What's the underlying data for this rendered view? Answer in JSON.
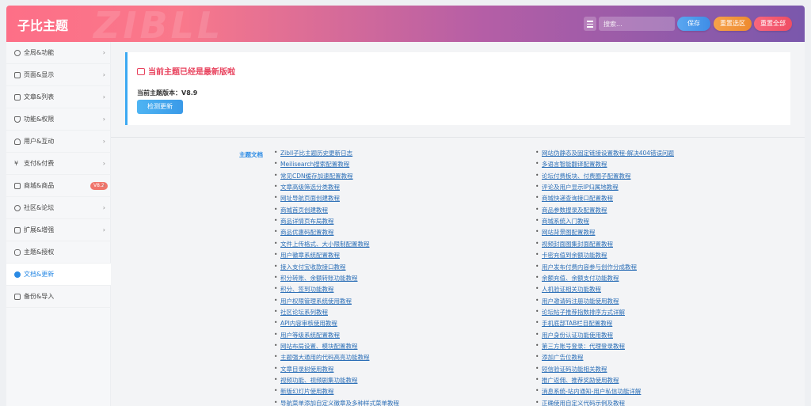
{
  "header": {
    "brand": "子比主题",
    "watermark": "ZIBLL",
    "search_placeholder": "搜索...",
    "save_label": "保存",
    "reset_section_label": "重置选区",
    "reset_all_label": "重置全部"
  },
  "sidebar": {
    "items": [
      {
        "label": "全局&功能",
        "icon": "globe-icon",
        "chevron": "›"
      },
      {
        "label": "页面&显示",
        "icon": "page-icon",
        "chevron": "›"
      },
      {
        "label": "文章&列表",
        "icon": "map-icon",
        "chevron": "›"
      },
      {
        "label": "功能&权限",
        "icon": "shield-icon",
        "chevron": "›"
      },
      {
        "label": "用户&互动",
        "icon": "user-icon",
        "chevron": "›"
      },
      {
        "label": "支付&付费",
        "icon": "yen-icon",
        "chevron": "›"
      },
      {
        "label": "商城&商品",
        "icon": "shop-icon",
        "chevron": "›",
        "badge": "V8.2"
      },
      {
        "label": "社区&论坛",
        "icon": "community-icon",
        "chevron": "›"
      },
      {
        "label": "扩展&增强",
        "icon": "puzzle-icon",
        "chevron": "›"
      },
      {
        "label": "主题&授权",
        "icon": "handshake-icon",
        "chevron": ""
      },
      {
        "label": "文档&更新",
        "icon": "cloud-download-icon",
        "chevron": "",
        "active": true
      },
      {
        "label": "备份&导入",
        "icon": "copy-icon",
        "chevron": ""
      }
    ]
  },
  "notice": {
    "title": "当前主题已经是最新版啦",
    "version_text": "当前主题版本：V8.9",
    "check_button": "检测更新"
  },
  "docs": {
    "label": "主题文档",
    "left_links": [
      "Zibll子比主题历史更新日志",
      "Meilisearch搜索配置教程",
      "常见CDN缓存加速配置教程",
      "文章高级筛选分类教程",
      "网址导航页面创建教程",
      "商城首页创建教程",
      "商品详情页布局教程",
      "商品优惠码配置教程",
      "文件上传格式、大小限制配置教程",
      "用户徽章系统配置教程",
      "接入支付宝收款接口教程",
      "积分转账、余额转账功能教程",
      "积分、签到功能教程",
      "用户权限管理系统使用教程",
      "社区论坛系列教程",
      "API内容审核使用教程",
      "用户等级系统配置教程",
      "网站布局设置、模块配置教程",
      "主题强大通用的代码高亮功能教程",
      "文章目录树使用教程",
      "视频功能、视频剧集功能教程",
      "新版幻灯片使用教程",
      "导航菜单添加自定义徽章及多种样式菜单教程"
    ],
    "right_links": [
      "网站伪静态及固定链接设置教程-解决404错误问题",
      "多语言智能翻译配置教程",
      "论坛付费板块、付费圈子配置教程",
      "评论及用户显示IP归属地教程",
      "商城快递查询接口配置教程",
      "商品参数搜录及配置教程",
      "商城系统入门教程",
      "网站背景图配置教程",
      "视频封面图集封面配置教程",
      "卡密充值到余额功能教程",
      "用户发布付费内容参与创作分成教程",
      "余额充值、余额支付功能教程",
      "人机验证相关功能教程",
      "用户邀请码注册功能使用教程",
      "论坛帖子推荐指数排序方式详解",
      "手机底部TAB栏目配置教程",
      "用户身份认证功能使用教程",
      "第三方账号登录：代理登录教程",
      "添加广告位教程",
      "短信验证码功能相关教程",
      "推广返佣、推荐奖励使用教程",
      "消息系统-站内通知-用户私信功能详解",
      "正确使用自定义代码示例及教程"
    ]
  }
}
